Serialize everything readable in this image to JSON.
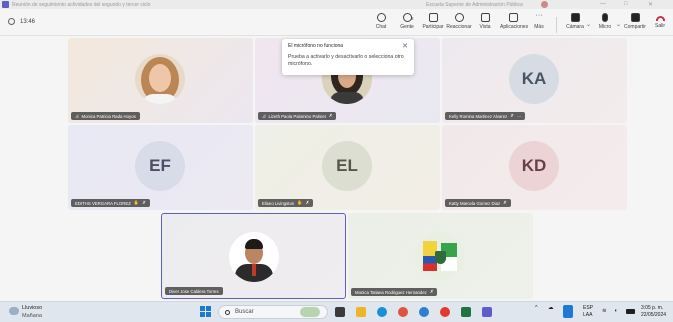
{
  "window": {
    "title": "Reunión de seguimiento actividades del segundo y tercer ciclo",
    "organization": "Escuela Superior de Administración Pública",
    "controls": [
      "—",
      "□",
      "✕"
    ]
  },
  "meeting": {
    "elapsed": "13:46",
    "toolbar": [
      {
        "id": "chat",
        "label": "Chat",
        "icon": "chat-bubble-icon"
      },
      {
        "id": "people",
        "label": "Gente",
        "icon": "people-icon",
        "badge": "8"
      },
      {
        "id": "raise",
        "label": "Participar",
        "icon": "raise-hand-icon"
      },
      {
        "id": "react",
        "label": "Reaccionar",
        "icon": "smiley-icon"
      },
      {
        "id": "view",
        "label": "Vista",
        "icon": "grid-view-icon"
      },
      {
        "id": "apps",
        "label": "Aplicaciones",
        "icon": "apps-icon"
      },
      {
        "id": "more",
        "label": "Más",
        "icon": "ellipsis-icon"
      },
      {
        "id": "camera",
        "label": "Cámara",
        "icon": "camera-off-icon"
      },
      {
        "id": "mic",
        "label": "Micro",
        "icon": "mic-icon"
      },
      {
        "id": "share",
        "label": "Compartir",
        "icon": "share-screen-icon"
      },
      {
        "id": "leave",
        "label": "Salir",
        "icon": "hang-up-icon"
      }
    ]
  },
  "popover": {
    "title": "El micrófono no funciona",
    "body": "Prueba a activarlo y desactivarlo o selecciona otro micrófono.",
    "close": "✕"
  },
  "participants": [
    {
      "name": "Monica Patricia Rada Hoyos",
      "kind": "photo",
      "photo": "monica"
    },
    {
      "name": "Lizeth Paola Palomino Palmet",
      "kind": "photo",
      "photo": "lizeth"
    },
    {
      "name": "Kelly Romina Martinez Alvarez",
      "kind": "initials",
      "initials": "KA"
    },
    {
      "name": "EDITHS VERGARA FLOREZ",
      "kind": "initials",
      "initials": "EF"
    },
    {
      "name": "Eliseo Livingston",
      "kind": "initials",
      "initials": "EL"
    },
    {
      "name": "Katty Marcela Gomez Diaz",
      "kind": "initials",
      "initials": "KD"
    },
    {
      "name": "Diver Jose Caldera Torres",
      "kind": "photo",
      "photo": "diver"
    },
    {
      "name": "Monica Tatiana Rodriguez Hernandez",
      "kind": "photo",
      "photo": "monicat"
    }
  ],
  "taskbar": {
    "weather_title": "Lluvioso",
    "weather_sub": "Mañana",
    "search_placeholder": "Buscar",
    "language_line1": "ESP",
    "language_line2": "LAA",
    "time": "3:05 p. m.",
    "date": "22/05/2024"
  },
  "colors": {
    "accent": "#5b5fc7",
    "leave": "#c4314b"
  }
}
